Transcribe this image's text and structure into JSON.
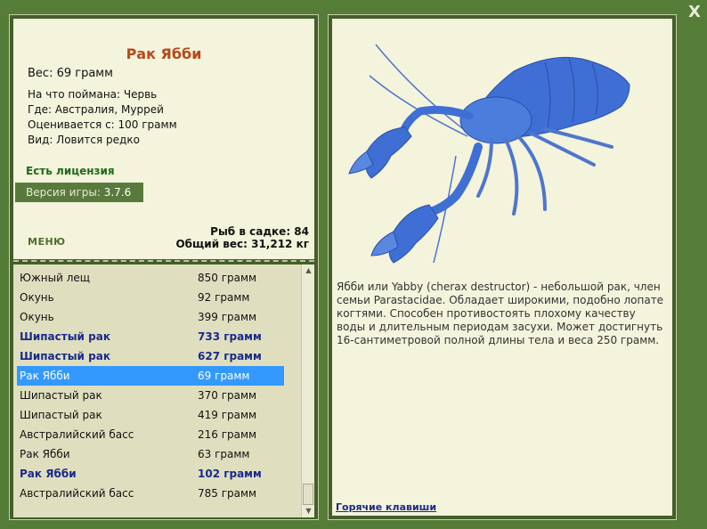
{
  "close_label": "X",
  "fish": {
    "title": "Рак Ябби",
    "weight": "Вес: 69 грамм",
    "details": [
      "На что поймана: Червь",
      "Где: Австралия, Муррей",
      "Оценивается с: 100 грамм",
      "Вид: Ловится редко"
    ],
    "license": "Есть лицензия",
    "version_label": "Версия игры:",
    "version_value": "3.7.6",
    "menu": "МЕНЮ",
    "stats": {
      "fish_count": "Рыб в садке: 84",
      "total_weight": "Общий вес: 31,212 кг"
    }
  },
  "list": [
    {
      "name": "Южный лещ",
      "weight": "850 грамм",
      "bold": false,
      "selected": false
    },
    {
      "name": "Окунь",
      "weight": "92 грамм",
      "bold": false,
      "selected": false
    },
    {
      "name": "Окунь",
      "weight": "399 грамм",
      "bold": false,
      "selected": false
    },
    {
      "name": "Шипастый рак",
      "weight": "733 грамм",
      "bold": true,
      "selected": false
    },
    {
      "name": "Шипастый рак",
      "weight": "627 грамм",
      "bold": true,
      "selected": false
    },
    {
      "name": "Рак Ябби",
      "weight": "69 грамм",
      "bold": false,
      "selected": true
    },
    {
      "name": "Шипастый рак",
      "weight": "370 грамм",
      "bold": false,
      "selected": false
    },
    {
      "name": "Шипастый рак",
      "weight": "419 грамм",
      "bold": false,
      "selected": false
    },
    {
      "name": "Австралийский басс",
      "weight": "216 грамм",
      "bold": false,
      "selected": false
    },
    {
      "name": "Рак Ябби",
      "weight": "63 грамм",
      "bold": false,
      "selected": false
    },
    {
      "name": "Рак Ябби",
      "weight": "102 грамм",
      "bold": true,
      "selected": false
    },
    {
      "name": "Австралийский басс",
      "weight": "785 грамм",
      "bold": false,
      "selected": false
    }
  ],
  "description": "Ябби или Yabby (cherax destructor) - небольшой рак, член семьи Parastacidae. Обладает широкими, подобно лопате когтями. Способен противостоять плохому качеству воды и длительным периодам засухи. Может достигнуть 16-сантиметровой полной длины тела и веса 250 грамм.",
  "hotkeys": "Горячие клавиши",
  "icons": {
    "close": "close-icon",
    "scroll_up": "scroll-up-arrow-icon",
    "scroll_down": "scroll-down-arrow-icon",
    "fish_image": "blue-yabby-crayfish-image"
  },
  "colors": {
    "frame": "#557d38",
    "panel": "#f4f3dc",
    "list_bg": "#dfdfc0",
    "title": "#b64a1a",
    "license": "#1f6a1a",
    "selected": "#3399ff",
    "rare_text": "#1a2a8a",
    "crayfish": "#3f6fd4"
  }
}
